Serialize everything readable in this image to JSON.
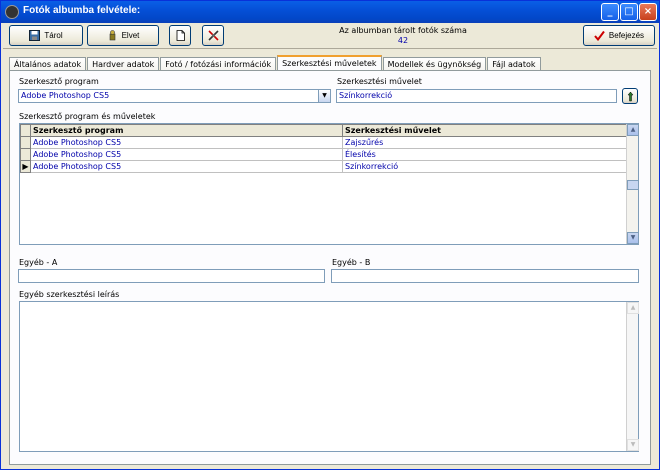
{
  "window": {
    "title": "Fotók albumba felvétele:"
  },
  "toolbar": {
    "save_label": "Tárol",
    "discard_label": "Elvet",
    "count_caption": "Az albumban tárolt fotók száma",
    "count_value": "42",
    "finish_label": "Befejezés"
  },
  "tabs": [
    {
      "label": "Általános adatok"
    },
    {
      "label": "Hardver adatok"
    },
    {
      "label": "Fotó / fotózási információk"
    },
    {
      "label": "Szerkesztési műveletek"
    },
    {
      "label": "Modellek és ügynökség"
    },
    {
      "label": "Fájl adatok"
    }
  ],
  "form": {
    "program_label": "Szerkesztő program",
    "program_value": "Adobe Photoshop CS5",
    "operation_label": "Szerkesztési művelet",
    "operation_value": "Színkorrekció",
    "grid_label": "Szerkesztő program és műveletek",
    "other_a_label": "Egyéb - A",
    "other_a_value": "",
    "other_b_label": "Egyéb - B",
    "other_b_value": "",
    "description_label": "Egyéb szerkesztési leírás",
    "description_value": ""
  },
  "grid": {
    "columns": [
      "Szerkesztő program",
      "Szerkesztési művelet"
    ],
    "rows": [
      [
        "Adobe Photoshop CS5",
        "Zajszűrés"
      ],
      [
        "Adobe Photoshop CS5",
        "Élesítés"
      ],
      [
        "Adobe Photoshop CS5",
        "Színkorrekció"
      ]
    ],
    "current_row_marker": "▶"
  },
  "colors": {
    "titlebar": "#0550d7",
    "accent_tab": "#f0a030",
    "value_text": "#0000aa"
  },
  "icons": [
    "app-icon",
    "save-icon",
    "undo-icon",
    "new-document-icon",
    "tools-icon",
    "checkmark-icon",
    "add-pen-icon"
  ]
}
